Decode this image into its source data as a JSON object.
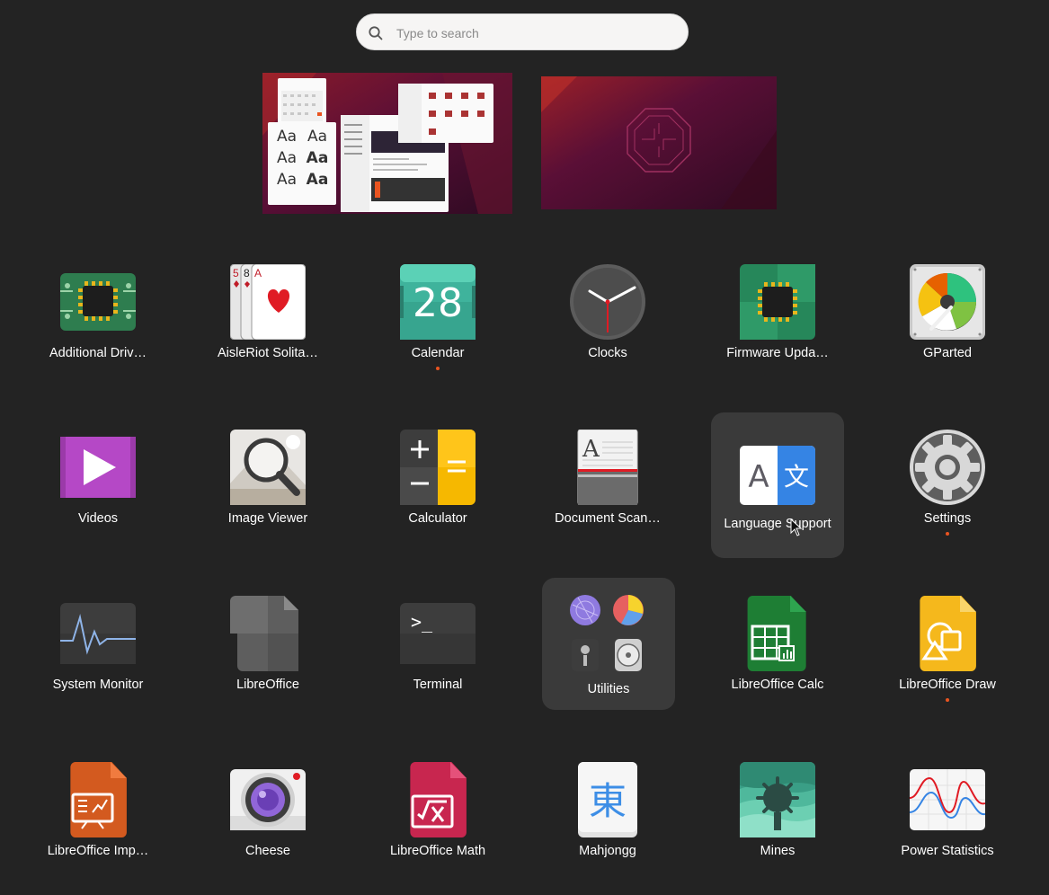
{
  "search": {
    "placeholder": "Type to search"
  },
  "workspaces": [
    {
      "name": "workspace-1"
    },
    {
      "name": "workspace-2"
    }
  ],
  "apps": [
    {
      "id": "additional-drivers",
      "label": "Additional Driv…",
      "icon": "chip-icon",
      "running": false
    },
    {
      "id": "aisleriot",
      "label": "AisleRiot Solita…",
      "icon": "playing-cards-icon",
      "running": false
    },
    {
      "id": "calendar",
      "label": "Calendar",
      "icon": "calendar-icon",
      "day": "28",
      "running": true
    },
    {
      "id": "clocks",
      "label": "Clocks",
      "icon": "clock-icon",
      "running": false
    },
    {
      "id": "firmware",
      "label": "Firmware Upda…",
      "icon": "firmware-chip-icon",
      "running": false
    },
    {
      "id": "gparted",
      "label": "GParted",
      "icon": "hard-disk-icon",
      "running": false
    },
    {
      "id": "videos",
      "label": "Videos",
      "icon": "play-icon",
      "running": false
    },
    {
      "id": "image-viewer",
      "label": "Image Viewer",
      "icon": "magnifier-icon",
      "running": false
    },
    {
      "id": "calculator",
      "label": "Calculator",
      "icon": "calculator-icon",
      "running": false
    },
    {
      "id": "document-scanner",
      "label": "Document Scan…",
      "icon": "scanner-icon",
      "running": false
    },
    {
      "id": "language-support",
      "label": "Language Support",
      "icon": "language-icon",
      "running": false,
      "highlighted": true
    },
    {
      "id": "settings",
      "label": "Settings",
      "icon": "gear-icon",
      "running": true
    },
    {
      "id": "system-monitor",
      "label": "System Monitor",
      "icon": "monitor-graph-icon",
      "running": false
    },
    {
      "id": "libreoffice",
      "label": "LibreOffice",
      "icon": "libreoffice-icon",
      "running": false
    },
    {
      "id": "terminal",
      "label": "Terminal",
      "icon": "terminal-icon",
      "prompt": ">_",
      "running": false
    },
    {
      "id": "utilities",
      "label": "Utilities",
      "icon": "folder-icon",
      "running": false,
      "folder": true
    },
    {
      "id": "libreoffice-calc",
      "label": "LibreOffice Calc",
      "icon": "spreadsheet-icon",
      "running": false
    },
    {
      "id": "libreoffice-draw",
      "label": "LibreOffice Draw",
      "icon": "draw-shapes-icon",
      "running": true
    },
    {
      "id": "libreoffice-impress",
      "label": "LibreOffice Imp…",
      "icon": "presentation-icon",
      "running": false
    },
    {
      "id": "cheese",
      "label": "Cheese",
      "icon": "camera-icon",
      "running": false
    },
    {
      "id": "libreoffice-math",
      "label": "LibreOffice Math",
      "icon": "formula-icon",
      "running": false
    },
    {
      "id": "mahjongg",
      "label": "Mahjongg",
      "icon": "mahjong-tile-icon",
      "glyph": "東",
      "running": false
    },
    {
      "id": "mines",
      "label": "Mines",
      "icon": "mine-icon",
      "running": false
    },
    {
      "id": "power-statistics",
      "label": "Power Statistics",
      "icon": "power-graph-icon",
      "running": false
    }
  ],
  "font_preview": {
    "glyph": "Aa"
  },
  "colors": {
    "accent": "#e95420",
    "background": "#232323",
    "highlight": "#3a3a3a"
  }
}
